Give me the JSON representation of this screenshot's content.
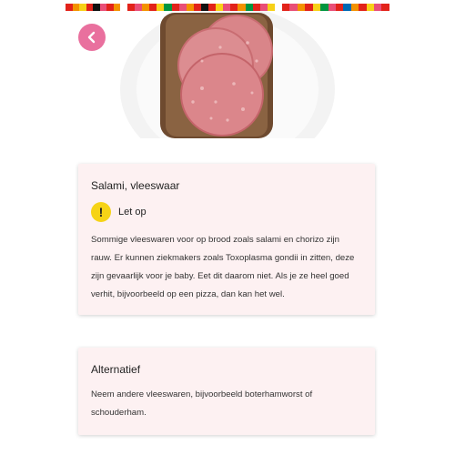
{
  "strip_colors": {
    "a": [
      "#e2231a",
      "#f39200",
      "#f7d117",
      "#e2231a",
      "#111111",
      "#e94e77",
      "#e2231a",
      "#f39200"
    ],
    "b": [
      "#e2231a",
      "#e94e77",
      "#f39200",
      "#e2231a",
      "#f7d117",
      "#009640",
      "#e2231a",
      "#e94e77",
      "#f39200",
      "#e2231a",
      "#111111",
      "#e2231a",
      "#f7d117",
      "#e94e77",
      "#e2231a",
      "#f39200",
      "#009640",
      "#e2231a",
      "#e94e77",
      "#f7d117"
    ],
    "c": [
      "#e2231a",
      "#e94e77",
      "#f39200",
      "#e2231a",
      "#f7d117",
      "#009640",
      "#e94e77",
      "#e2231a",
      "#0069b4",
      "#f39200",
      "#e2231a",
      "#f7d117",
      "#e94e77",
      "#e2231a"
    ]
  },
  "hero": {
    "image_icon": "salami-on-bread-image"
  },
  "back_button": {
    "icon": "chevron-left-icon",
    "color": "#e9709e"
  },
  "card_salami": {
    "title": "Salami, vleeswaar",
    "warning_label": "Let op",
    "warning_icon_char": "!",
    "warning_color": "#f6d316",
    "body": "Sommige vleeswaren voor op brood zoals salami en chorizo zijn rauw. Er kunnen ziekmakers zoals Toxoplasma gondii in zitten, deze zijn gevaarlijk voor je baby. Eet dit daarom niet. Als je ze heel goed verhit, bijvoorbeeld op een pizza, dan kan het wel."
  },
  "card_alternative": {
    "title": "Alternatief",
    "body": "Neem andere vleeswaren, bijvoorbeeld boterhamworst of schouderham."
  }
}
